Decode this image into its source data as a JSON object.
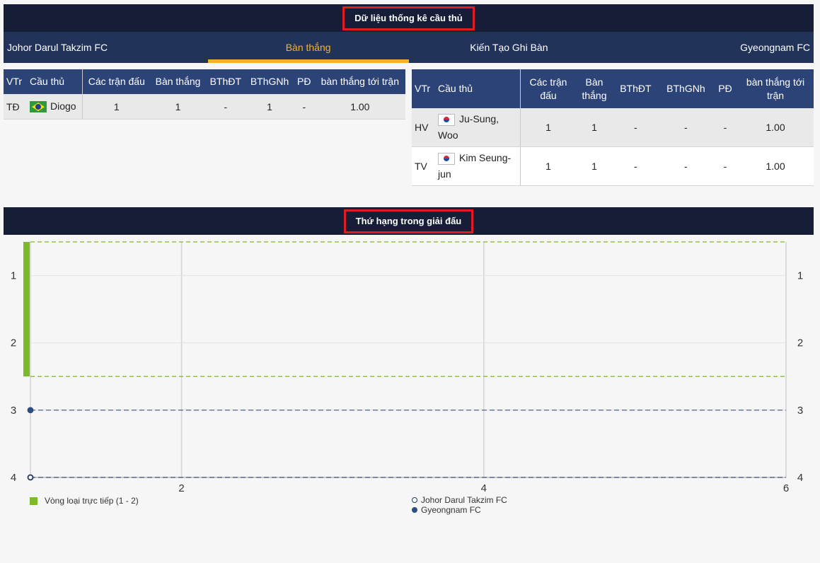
{
  "stats_section": {
    "title": "Dữ liệu thống kê cầu thủ"
  },
  "tabs": [
    {
      "label": "Johor Darul Takzim FC"
    },
    {
      "label": "Bàn thắng",
      "active": true
    },
    {
      "label": "Kiến Tạo Ghi Bàn"
    },
    {
      "label": "Gyeongnam FC"
    }
  ],
  "colors": {
    "header_bg": "#161e37",
    "tabbar_bg": "#22335a",
    "table_header_bg": "#2c4378",
    "active_tab": "#f2b227",
    "highlight_border": "#e21b23",
    "qualify_green": "#7db928",
    "johor_line": "#1f3566",
    "gyeongnam_line": "#2d4c80"
  },
  "left_table": {
    "headers": [
      "VTr",
      "Cầu thủ",
      "Các trận đấu",
      "Bàn thắng",
      "BThĐT",
      "BThGNh",
      "PĐ",
      "bàn thắng tới trận"
    ],
    "rows": [
      {
        "pos": "TĐ",
        "flag": "brazil-flag-icon",
        "player": "Diogo",
        "matches": "1",
        "goals": "1",
        "bthdt": "-",
        "bthgnh": "1",
        "pd": "-",
        "ratio": "1.00"
      }
    ]
  },
  "right_table": {
    "headers": [
      "VTr",
      "Cầu thủ",
      "Các trận đấu",
      "Bàn thắng",
      "BThĐT",
      "BThGNh",
      "PĐ",
      "bàn thắng tới trận"
    ],
    "rows": [
      {
        "pos": "HV",
        "flag": "south-korea-flag-icon",
        "player": "Ju-Sung, Woo",
        "matches": "1",
        "goals": "1",
        "bthdt": "-",
        "bthgnh": "-",
        "pd": "-",
        "ratio": "1.00"
      },
      {
        "pos": "TV",
        "flag": "south-korea-flag-icon",
        "player": "Kim Seung-jun",
        "matches": "1",
        "goals": "1",
        "bthdt": "-",
        "bthgnh": "-",
        "pd": "-",
        "ratio": "1.00"
      }
    ]
  },
  "ranking_section": {
    "title": "Thứ hạng trong giải đấu"
  },
  "chart_data": {
    "type": "line",
    "x_range": [
      1,
      6
    ],
    "y_range": [
      4,
      0.5
    ],
    "y_inverted": true,
    "x_ticks": [
      "2",
      "4",
      "6"
    ],
    "y_ticks": [
      "1",
      "2",
      "3",
      "4"
    ],
    "grid": true,
    "qualification_band": {
      "label": "Vòng loại trực tiếp (1 - 2)",
      "from": 1,
      "to": 2
    },
    "series": [
      {
        "name": "Johor Darul Takzim FC",
        "marker": "hollow-circle",
        "x": [
          1
        ],
        "y": [
          4
        ]
      },
      {
        "name": "Gyeongnam FC",
        "marker": "filled-circle",
        "x": [
          1
        ],
        "y": [
          3
        ]
      }
    ],
    "legend_placement": "bottom"
  }
}
